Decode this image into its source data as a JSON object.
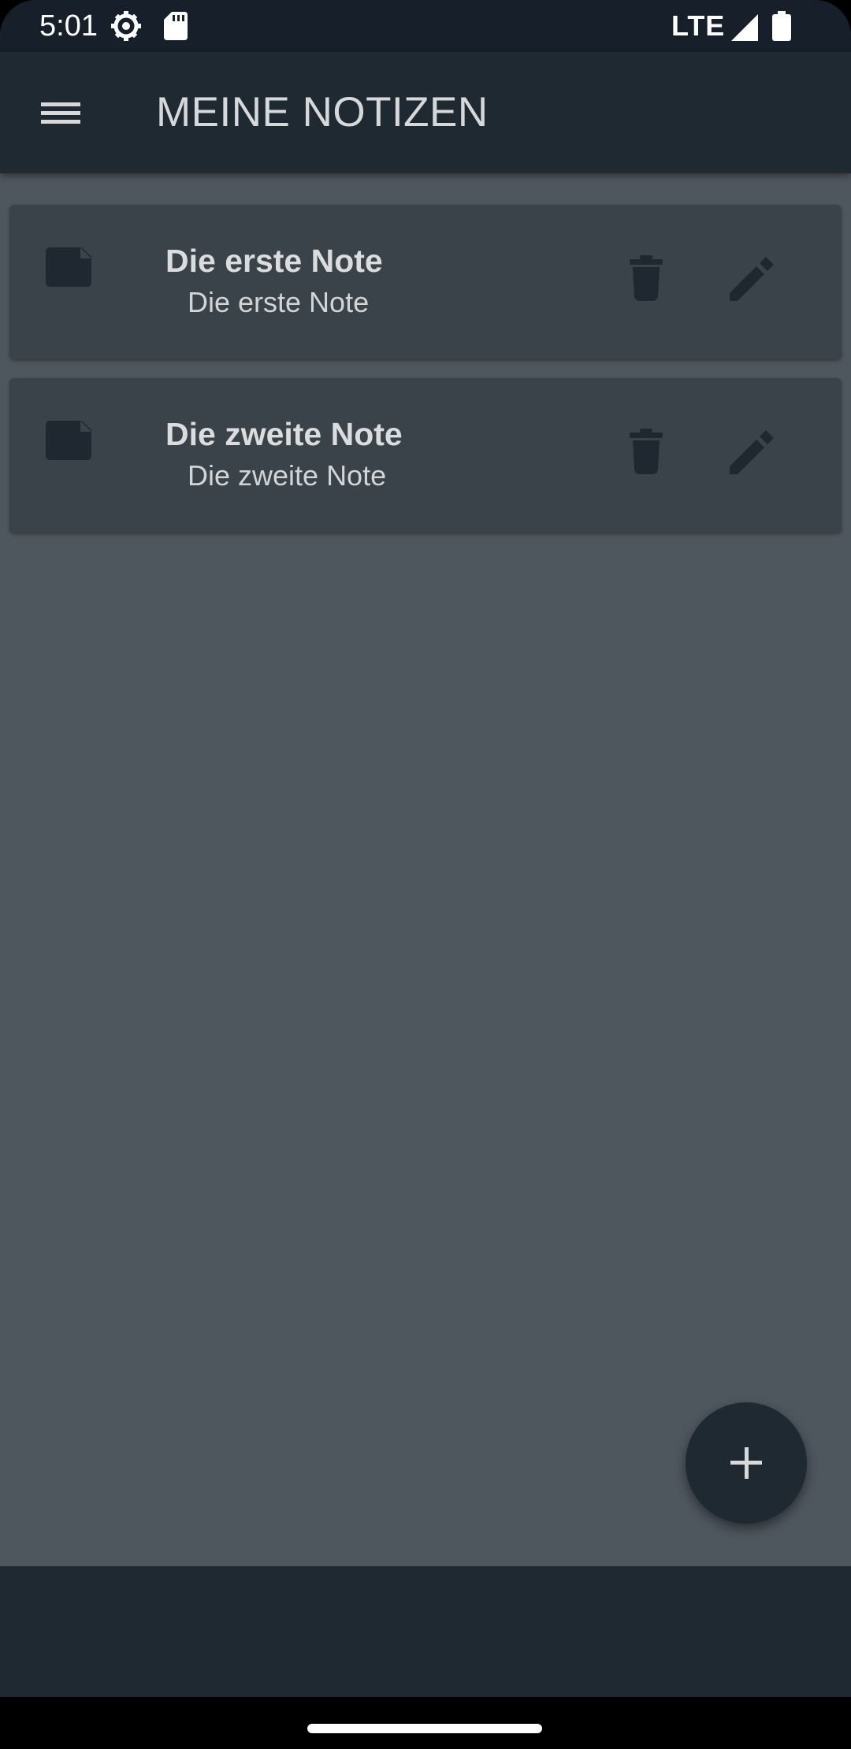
{
  "status_bar": {
    "time": "5:01",
    "network": "LTE",
    "icons": [
      "settings-gear-icon",
      "sd-card-icon",
      "signal-icon",
      "battery-icon"
    ]
  },
  "app_bar": {
    "title": "MEINE NOTIZEN",
    "menu_icon": "hamburger-menu-icon"
  },
  "notes": [
    {
      "title": "Die erste Note",
      "subtitle": "Die erste Note"
    },
    {
      "title": "Die zweite Note",
      "subtitle": "Die zweite Note"
    }
  ],
  "fab": {
    "icon": "plus-icon"
  },
  "colors": {
    "background": "#4e565e",
    "app_bar": "#1e2931",
    "card": "#3a4349",
    "icon_dark": "#1f2830",
    "text_light": "#dadcde"
  }
}
